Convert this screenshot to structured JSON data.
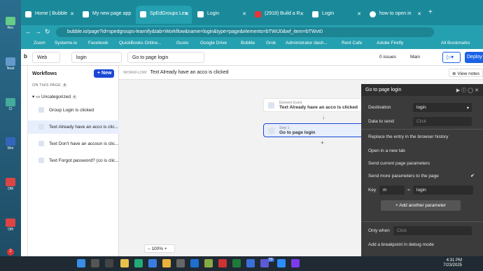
{
  "desktop": {
    "icons": [
      "Rec",
      "Neat",
      "Cl",
      "Wor",
      "Offi",
      "Offi"
    ],
    "badge": "2"
  },
  "browser": {
    "tabs": [
      {
        "label": "Home | Bubble",
        "active": false
      },
      {
        "label": "My new page app",
        "active": false
      },
      {
        "label": "SpEdGroups Lea",
        "active": true
      },
      {
        "label": "Login",
        "active": false
      },
      {
        "label": "(2918) Build a R",
        "active": false
      },
      {
        "label": "Login",
        "active": false
      },
      {
        "label": "how to open in",
        "active": false
      }
    ],
    "url": "bubble.io/page?id=spedgroups-learnify&tab=Workflow&name=login&type=page&elements=bTWtJ0&wf_item=bTWvt0",
    "bookmarks": [
      "Zoom",
      "Systeme.io",
      "Facebook",
      "QuickBooks Online...",
      "Gusto",
      "Google Drive",
      "Bubble",
      "Grok",
      "Administrator dash...",
      "Rent Cafe",
      "Adobe Firefly",
      "All Bookmarks"
    ]
  },
  "topbar": {
    "logo": "b",
    "platform": "Web",
    "page": "login",
    "goto": "Go to page login",
    "issues": "0 issues",
    "branch": "Main",
    "deploy": "Deploy"
  },
  "workflows": {
    "title": "Workflows",
    "new_label": "+ New",
    "on_this_page": "ON THIS PAGE",
    "on_this_page_count": "4",
    "category": "Uncategorized",
    "category_count": "4",
    "items": [
      "Group Login is clicked",
      "Text Already have an acco is clic...",
      "Text Don't have an accoun is clic...",
      "Text Forgot password? (co is clic..."
    ]
  },
  "canvas": {
    "workflow_label": "WORKFLOW:",
    "workflow_name": "Text Already have an acco is clicked",
    "view_notes": "View notes",
    "event_sub": "Element Event",
    "event_main": "Text Already have an acco is clicked",
    "step_sub": "Step 1",
    "step_main": "Go to page login",
    "zoom": "100%"
  },
  "panel": {
    "title": "Go to page login",
    "destination_label": "Destination",
    "destination_value": "login",
    "data_label": "Data to send",
    "data_placeholder": "Click",
    "replace_label": "Replace the entry in the browser history",
    "newtab_label": "Open in a new tab",
    "current_params_label": "Send current page parameters",
    "more_params_label": "Send more parameters to the page",
    "key_label": "Key",
    "key_value": "m",
    "equals": "=",
    "param_value": "login",
    "add_param": "+ Add another parameter",
    "only_when_label": "Only when",
    "only_when_placeholder": "Click",
    "breakpoint_label": "Add a breakpoint in debug mode"
  },
  "taskbar": {
    "time": "4:31 PM",
    "date": "7/23/2025",
    "notif": "59"
  }
}
